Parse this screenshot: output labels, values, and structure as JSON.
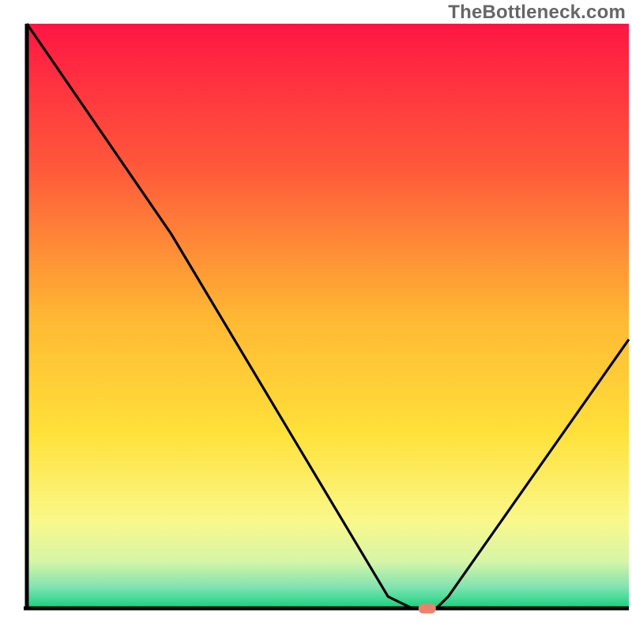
{
  "watermark": "TheBottleneck.com",
  "chart_data": {
    "type": "line",
    "title": "",
    "xlabel": "",
    "ylabel": "",
    "xlim": [
      0,
      100
    ],
    "ylim": [
      0,
      100
    ],
    "grid": false,
    "legend": false,
    "curve_points": [
      {
        "x": 0,
        "y": 100
      },
      {
        "x": 24,
        "y": 64
      },
      {
        "x": 60,
        "y": 2
      },
      {
        "x": 64,
        "y": 0
      },
      {
        "x": 68,
        "y": 0
      },
      {
        "x": 70,
        "y": 2
      },
      {
        "x": 100,
        "y": 46
      }
    ],
    "optimum_marker": {
      "x": 66.5,
      "y": 0
    },
    "background_gradient_stops": [
      {
        "pos": 0.0,
        "color": "#ff1644"
      },
      {
        "pos": 0.25,
        "color": "#ff5a3a"
      },
      {
        "pos": 0.5,
        "color": "#ffb733"
      },
      {
        "pos": 0.7,
        "color": "#ffe13a"
      },
      {
        "pos": 0.85,
        "color": "#faf88a"
      },
      {
        "pos": 0.92,
        "color": "#d6f5a8"
      },
      {
        "pos": 0.965,
        "color": "#7de3b0"
      },
      {
        "pos": 1.0,
        "color": "#12d27e"
      }
    ],
    "axis_color": "#000000",
    "curve_color": "#000000",
    "marker_color": "#e9836f"
  }
}
